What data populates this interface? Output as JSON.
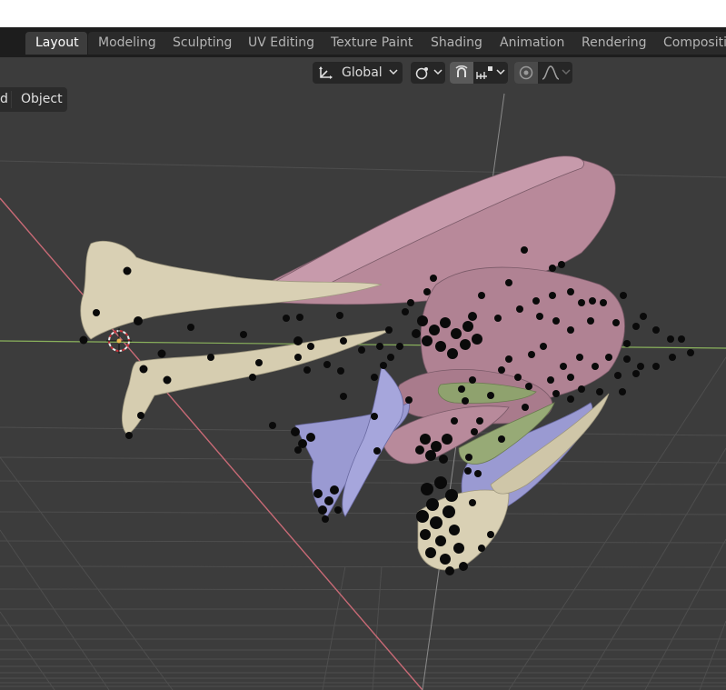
{
  "workspace_tabs": [
    {
      "label": "Layout",
      "active": true
    },
    {
      "label": "Modeling",
      "active": false
    },
    {
      "label": "Sculpting",
      "active": false
    },
    {
      "label": "UV Editing",
      "active": false
    },
    {
      "label": "Texture Paint",
      "active": false
    },
    {
      "label": "Shading",
      "active": false
    },
    {
      "label": "Animation",
      "active": false
    },
    {
      "label": "Rendering",
      "active": false
    },
    {
      "label": "Compositin",
      "active": false
    }
  ],
  "viewport_header": {
    "transform_orientation": "Global",
    "pivot_icon": "pivot-point-icon",
    "snap_icon": "magnet-snap-icon",
    "snap_target_icon": "snap-increment-icon",
    "proportional_icon": "proportional-edit-icon",
    "falloff_icon": "falloff-curve-icon"
  },
  "viewport_menu": {
    "partial_item": "d",
    "object": "Object"
  },
  "colors": {
    "header_bg": "#1d1d1d",
    "viewport_bg": "#3c3c3c",
    "bone": "#d9d0b4",
    "muscle_pink": "#b8899a",
    "muscle_blue": "#9a9ad2",
    "muscle_green": "#8fa26e",
    "x_axis": "#c96a76",
    "y_axis": "#8ab25c"
  }
}
